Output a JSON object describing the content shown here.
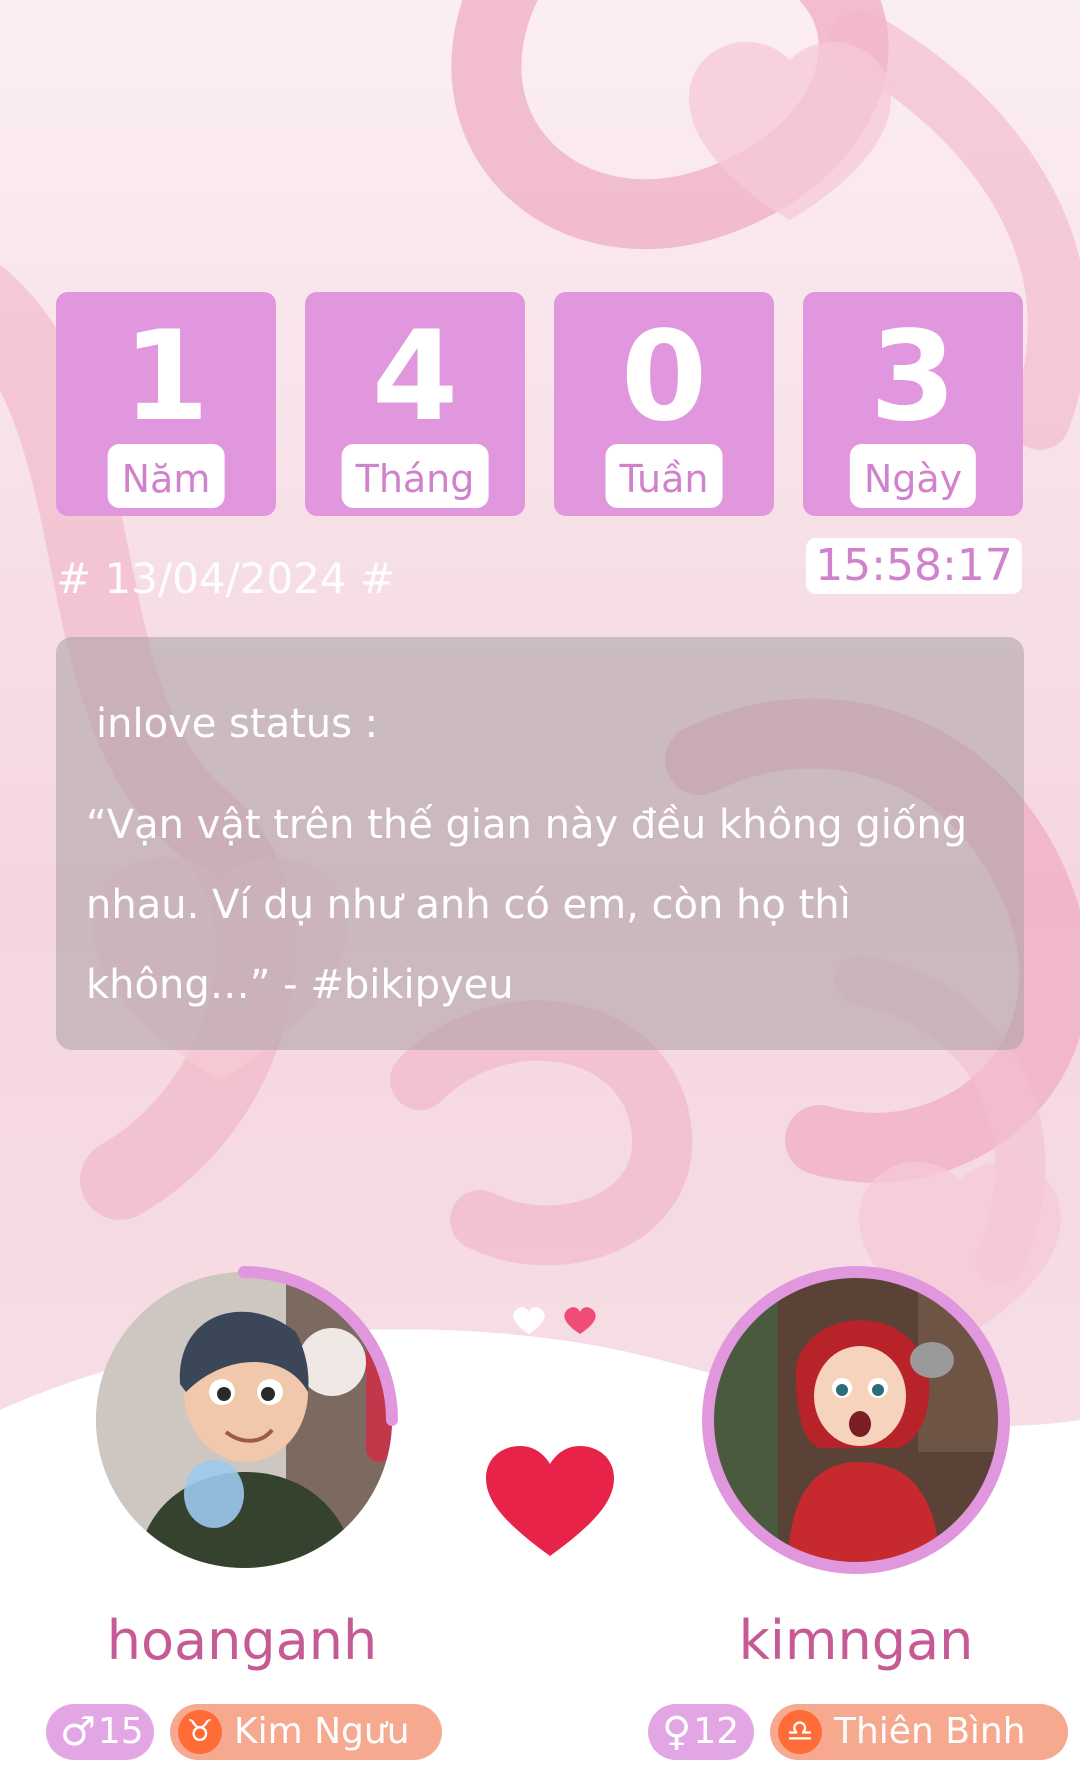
{
  "counter": {
    "years": {
      "value": "1",
      "label": "Năm"
    },
    "months": {
      "value": "4",
      "label": "Tháng"
    },
    "weeks": {
      "value": "0",
      "label": "Tuần"
    },
    "days": {
      "value": "3",
      "label": "Ngày"
    }
  },
  "start_date": "# 13/04/2024 #",
  "clock": "15:58:17",
  "status": {
    "heading": "inlove status :",
    "quote": "“Vạn vật trên thế gian này đều không giống nhau. Ví dụ như anh có em, còn họ thì không…” - #bikipyeu"
  },
  "partner_left": {
    "name": "hoanganh",
    "gender_symbol": "♂",
    "age": "15",
    "zodiac_symbol": "♉",
    "zodiac": "Kim Ngưu"
  },
  "partner_right": {
    "name": "kimngan",
    "gender_symbol": "♀",
    "age": "12",
    "zodiac_symbol": "♎",
    "zodiac": "Thiên Bình"
  },
  "colors": {
    "counter_bg": "#e197de",
    "name_text": "#c65a95",
    "heart": "#e8234a",
    "zodiac_pill": "#f6a98e",
    "gender_pill": "#e3a6e4"
  }
}
